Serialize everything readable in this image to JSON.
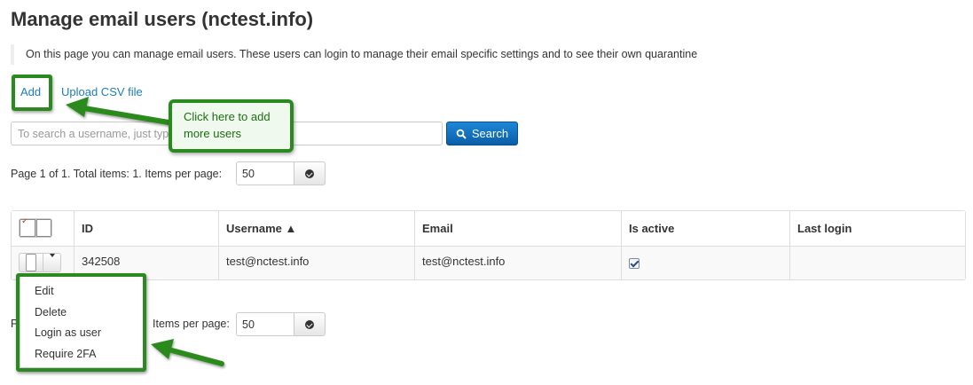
{
  "page": {
    "title": "Manage email users (nctest.info)",
    "description": "On this page you can manage email users. These users can login to manage their email specific settings and to see their own quarantine"
  },
  "actions": {
    "add_label": "Add",
    "upload_label": "Upload CSV file"
  },
  "search": {
    "placeholder": "To search a username, just type",
    "button_label": "Search"
  },
  "pager_top": {
    "text": "Page 1 of 1. Total items: 1. Items per page:",
    "per_page": "50"
  },
  "table": {
    "columns": [
      "ID",
      "Username ▲",
      "Email",
      "Is active",
      "Last login"
    ],
    "rows": [
      {
        "id": "342508",
        "username": "test@nctest.info",
        "email": "test@nctest.info",
        "is_active": true,
        "last_login": ""
      }
    ]
  },
  "row_menu": {
    "items": [
      "Edit",
      "Delete",
      "Login as user",
      "Require 2FA"
    ]
  },
  "pager_bottom": {
    "text_visible": "Items per page:",
    "text_prefix_visible": "P",
    "per_page": "50"
  },
  "annotation": {
    "callout_text": "Click here to add more users",
    "color": "#2a8a1f"
  },
  "colors": {
    "link": "#1d7dbf",
    "primary_button": "#0b5ea8",
    "annotation_green": "#2a8a1f"
  }
}
